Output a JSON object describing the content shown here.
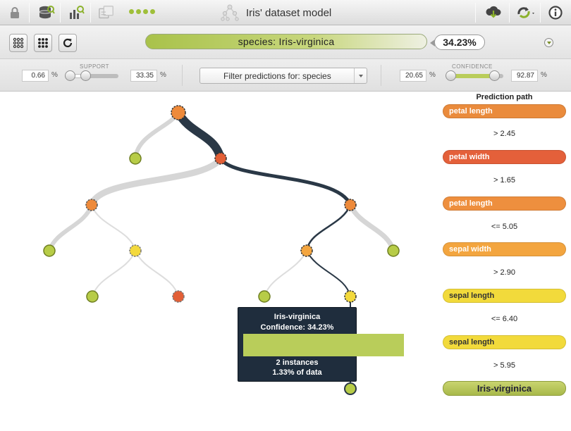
{
  "window": {
    "title": "Iris' dataset model"
  },
  "prediction": {
    "label": "species: Iris-virginica",
    "confidence_text": "34.23%",
    "confidence": 0.3423
  },
  "support": {
    "label": "SUPPORT",
    "min": "0.66",
    "max": "33.35",
    "unit": "%"
  },
  "confidence_filter": {
    "label": "CONFIDENCE",
    "min": "20.65",
    "max": "92.87",
    "unit": "%"
  },
  "filter": {
    "label": "Filter predictions for: species"
  },
  "tooltip": {
    "title": "Iris-virginica",
    "confidence": "Confidence: 34.23%",
    "confidence_value": 0.3423,
    "instances": "2 instances",
    "data_fraction": "1.33% of data"
  },
  "prediction_path": {
    "title": "Prediction path",
    "steps": [
      {
        "field": "petal length",
        "condition": "> 2.45",
        "color": "#ea8b3c"
      },
      {
        "field": "petal width",
        "condition": "> 1.65",
        "color": "#e4603a"
      },
      {
        "field": "petal length",
        "condition": "<= 5.05",
        "color": "#ee8f3e"
      },
      {
        "field": "sepal width",
        "condition": "> 2.90",
        "color": "#f3a53f"
      },
      {
        "field": "sepal length",
        "condition": "<= 6.40",
        "color": "#f2da3b"
      },
      {
        "field": "sepal length",
        "condition": "> 5.95",
        "color": "#f2da3b"
      }
    ],
    "result": "Iris-virginica"
  },
  "colors": {
    "leaf": "#b7cc47",
    "orange": "#ee8a3a",
    "red": "#e35f36",
    "yellow": "#f3d93c",
    "path": "#2a3846",
    "branch": "#d6d6d6"
  },
  "icons": [
    "lock-icon",
    "dataset-icon",
    "chart-icon",
    "compare-icon",
    "model-icon",
    "download-icon",
    "refresh-icon",
    "info-icon"
  ]
}
